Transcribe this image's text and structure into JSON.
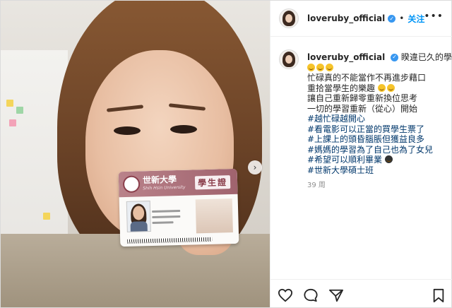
{
  "media": {
    "card_school": "世新大學",
    "card_school_en": "Shih Hsin University",
    "card_title": "學生證",
    "next_glyph": "›"
  },
  "header": {
    "username": "loveruby_official",
    "verified_glyph": "✓",
    "separator": "•",
    "follow_label": "关注",
    "more_glyph": "•••"
  },
  "caption": {
    "username": "loveruby_official",
    "verified_glyph": "✓",
    "first": " 睽違已久的學生證",
    "lines": [
      "忙碌真的不能當作不再進步藉口",
      "重拾當學生的樂趣",
      "讓自己重新歸零重新換位思考",
      "一切的學習重新（從心）開始"
    ],
    "hashtags": [
      "#越忙碌越開心",
      "#看電影可以正當的買學生票了",
      "#上課上的頭昏腦脹但獲益良多",
      "#媽媽的學習為了自己也為了女兒",
      "#希望可以順利畢業",
      "#世新大學碩士班"
    ],
    "timestamp": "39 周"
  },
  "actions": [
    "heart-icon",
    "comment-icon",
    "share-icon",
    "bookmark-icon"
  ]
}
